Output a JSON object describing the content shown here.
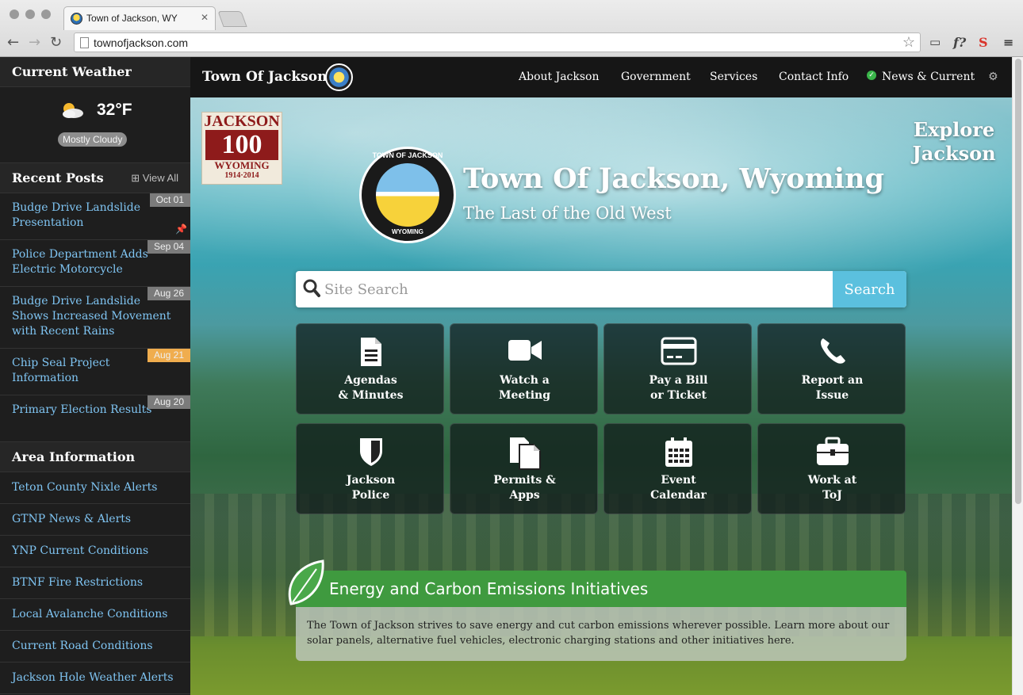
{
  "browser": {
    "tab_title": "Town of Jackson, WY",
    "url": "townofjackson.com",
    "ext_f": "f?",
    "ext_s": "S"
  },
  "sidebar": {
    "weather_heading": "Current Weather",
    "weather_temp": "32°F",
    "weather_condition": "Mostly Cloudy",
    "posts_heading": "Recent Posts",
    "view_all": "View All",
    "posts": [
      {
        "title": "Budge Drive Landslide Presentation",
        "date": "Oct 01",
        "pinned": true,
        "date_color": "#7b7b7b"
      },
      {
        "title": "Police Department Adds Electric Motorcycle",
        "date": "Sep 04",
        "pinned": false,
        "date_color": "#7b7b7b"
      },
      {
        "title": "Budge Drive Landslide Shows Increased Movement with Recent Rains",
        "date": "Aug 26",
        "pinned": false,
        "date_color": "#7b7b7b"
      },
      {
        "title": "Chip Seal Project Information",
        "date": "Aug 21",
        "pinned": false,
        "date_color": "#f0ad4e"
      },
      {
        "title": "Primary Election Results",
        "date": "Aug 20",
        "pinned": false,
        "date_color": "#7b7b7b"
      }
    ],
    "area_heading": "Area Information",
    "area_links": [
      "Teton County Nixle Alerts",
      "GTNP News & Alerts",
      "YNP Current Conditions",
      "BTNF Fire Restrictions",
      "Local Avalanche Conditions",
      "Current Road Conditions",
      "Jackson Hole Weather Alerts"
    ]
  },
  "topnav": {
    "site_name": "Town Of Jackson",
    "items": [
      "About Jackson",
      "Government",
      "Services",
      "Contact Info",
      "News & Current"
    ]
  },
  "hero": {
    "badge_top": "JACKSON",
    "badge_num": "100",
    "badge_bottom": "WYOMING",
    "badge_years": "1914·2014",
    "explore": "Explore Jackson",
    "seal_top": "TOWN OF JACKSON",
    "seal_bottom": "WYOMING",
    "title": "Town Of Jackson, Wyoming",
    "subtitle": "The Last of the Old West"
  },
  "search": {
    "placeholder": "Site Search",
    "button": "Search"
  },
  "tiles": [
    {
      "label": "Agendas\n& Minutes",
      "icon": "document-icon"
    },
    {
      "label": "Watch a\nMeeting",
      "icon": "video-camera-icon"
    },
    {
      "label": "Pay a Bill\nor Ticket",
      "icon": "credit-card-icon"
    },
    {
      "label": "Report an\nIssue",
      "icon": "phone-icon"
    },
    {
      "label": "Jackson\nPolice",
      "icon": "shield-icon"
    },
    {
      "label": "Permits &\nApps",
      "icon": "documents-icon"
    },
    {
      "label": "Event\nCalendar",
      "icon": "calendar-icon"
    },
    {
      "label": "Work at\nToJ",
      "icon": "briefcase-icon"
    }
  ],
  "energy": {
    "title": "Energy and Carbon Emissions Initiatives",
    "body": "The Town of Jackson strives to save energy and cut carbon emissions wherever possible. Learn more about our solar panels, alternative fuel vehicles, electronic charging stations and other initiatives here."
  }
}
